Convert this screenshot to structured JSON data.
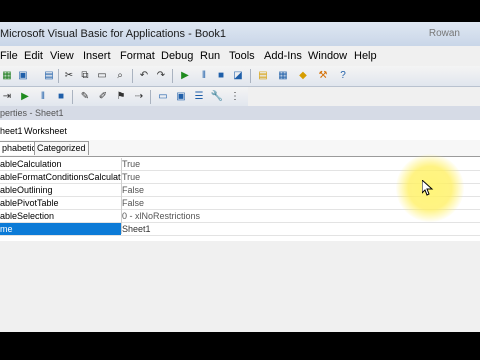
{
  "window": {
    "title": "Microsoft Visual Basic for Applications - Book1",
    "right_text": "Rowan"
  },
  "menus": [
    "File",
    "Edit",
    "View",
    "Insert",
    "Format",
    "Debug",
    "Run",
    "Tools",
    "Add-Ins",
    "Window",
    "Help"
  ],
  "toolbar": {
    "icons": [
      "excel-icon",
      "insert-module-icon",
      "save-icon",
      "cut-icon",
      "copy-icon",
      "paste-icon",
      "find-icon",
      "undo-icon",
      "redo-icon",
      "run-icon",
      "break-icon",
      "reset-icon",
      "design-mode-icon",
      "project-explorer-icon",
      "properties-window-icon",
      "object-browser-icon",
      "toolbox-icon",
      "help-icon"
    ],
    "edit_icons": [
      "indent-icon",
      "run-icon",
      "pause-icon",
      "stop-icon",
      "comment-icon",
      "uncomment-icon",
      "bookmark-icon",
      "next-bookmark-icon",
      "form-icon",
      "image-icon",
      "list-icon",
      "wrench-icon"
    ]
  },
  "properties": {
    "title": "perties - Sheet1",
    "object_name": "heet1",
    "object_type": "Worksheet",
    "tabs": [
      "phabetic",
      "Categorized"
    ],
    "rows": [
      {
        "name": "ableCalculation",
        "value": "True"
      },
      {
        "name": "ableFormatConditionsCalculation",
        "value": "True"
      },
      {
        "name": "ableOutlining",
        "value": "False"
      },
      {
        "name": "ablePivotTable",
        "value": "False"
      },
      {
        "name": "ableSelection",
        "value": "0 - xlNoRestrictions"
      },
      {
        "name": "me",
        "value": "Sheet1"
      }
    ]
  },
  "colors": {
    "selected": "#0c7bd7",
    "highlight": "#ffef5a",
    "titlebar": "#c9d6e8"
  }
}
